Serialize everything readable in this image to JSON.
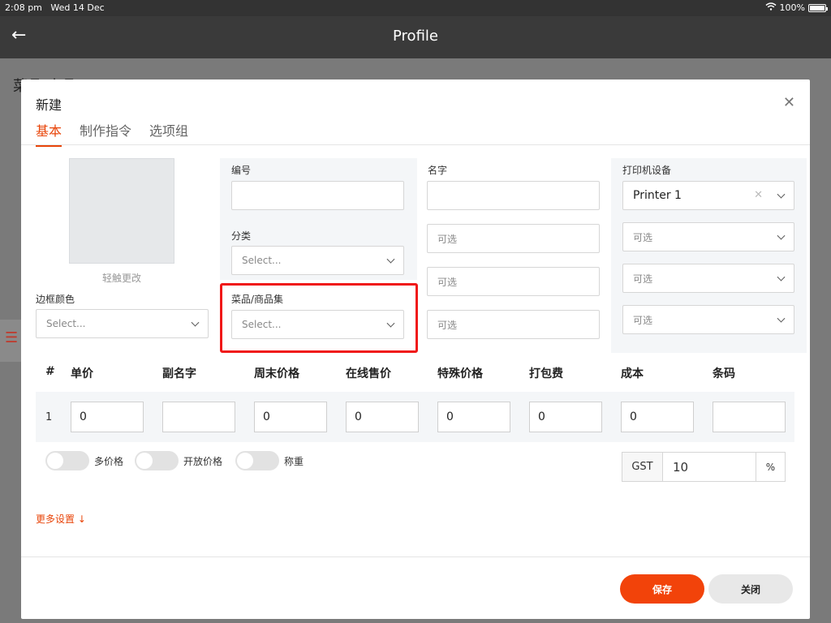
{
  "status": {
    "time": "2:08 pm",
    "date": "Wed 14 Dec",
    "battery": "100%"
  },
  "app": {
    "title": "Profile",
    "bg_title": "菜品/商品"
  },
  "modal": {
    "title": "新建",
    "tabs": [
      {
        "label": "基本",
        "active": true
      },
      {
        "label": "制作指令"
      },
      {
        "label": "选项组"
      }
    ],
    "image_caption": "轻触更改",
    "border_color": {
      "label": "边框颜色",
      "placeholder": "Select..."
    },
    "code": {
      "label": "编号",
      "value": ""
    },
    "category": {
      "label": "分类",
      "placeholder": "Select..."
    },
    "item_set": {
      "label": "菜品/商品集",
      "placeholder": "Select..."
    },
    "name": {
      "label": "名字",
      "value": "",
      "optional": [
        "可选",
        "可选",
        "可选"
      ]
    },
    "printer": {
      "label": "打印机设备",
      "selected": "Printer 1",
      "optional": [
        "可选",
        "可选",
        "可选"
      ]
    },
    "price_table": {
      "headers": [
        "#",
        "单价",
        "副名字",
        "周末价格",
        "在线售价",
        "特殊价格",
        "打包费",
        "成本",
        "条码"
      ],
      "rows": [
        {
          "num": "1",
          "values": [
            "0",
            "",
            "0",
            "0",
            "0",
            "0",
            "0",
            ""
          ]
        }
      ]
    },
    "toggles": [
      "多价格",
      "开放价格",
      "称重"
    ],
    "gst": {
      "label": "GST",
      "value": "10",
      "unit": "%"
    },
    "more_settings": "更多设置 ↓",
    "buttons": {
      "save": "保存",
      "close": "关闭"
    }
  }
}
